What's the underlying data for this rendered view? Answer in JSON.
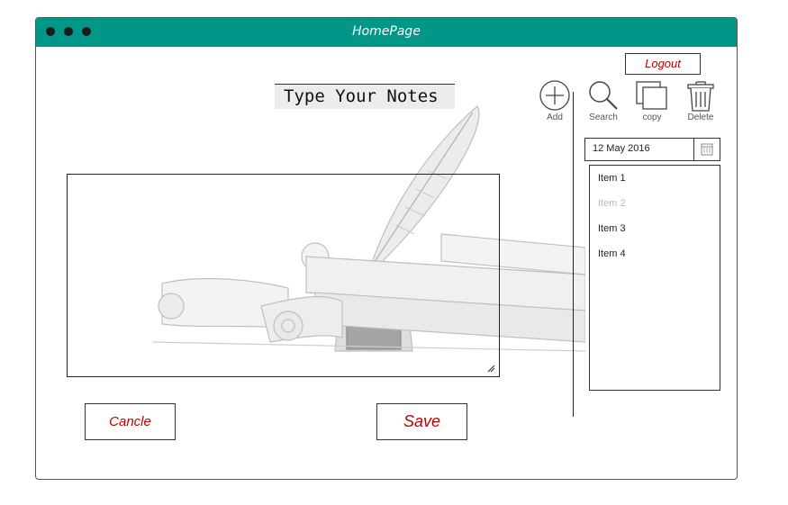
{
  "window": {
    "title": "HomePage"
  },
  "header": {
    "logout_label": "Logout"
  },
  "editor": {
    "title": "Type Your Notes"
  },
  "actions": {
    "cancel_label": "Cancle",
    "save_label": "Save"
  },
  "toolbar": {
    "add_label": "Add",
    "search_label": "Search",
    "copy_label": "copy",
    "delete_label": "Delete"
  },
  "date_picker": {
    "value": "12 May 2016"
  },
  "list": {
    "items": [
      {
        "label": "Item 1",
        "disabled": false
      },
      {
        "label": "Item 2",
        "disabled": true
      },
      {
        "label": "Item 3",
        "disabled": false
      },
      {
        "label": "Item 4",
        "disabled": false
      }
    ]
  },
  "colors": {
    "titlebar": "#009688",
    "accent_text": "#c00000"
  }
}
